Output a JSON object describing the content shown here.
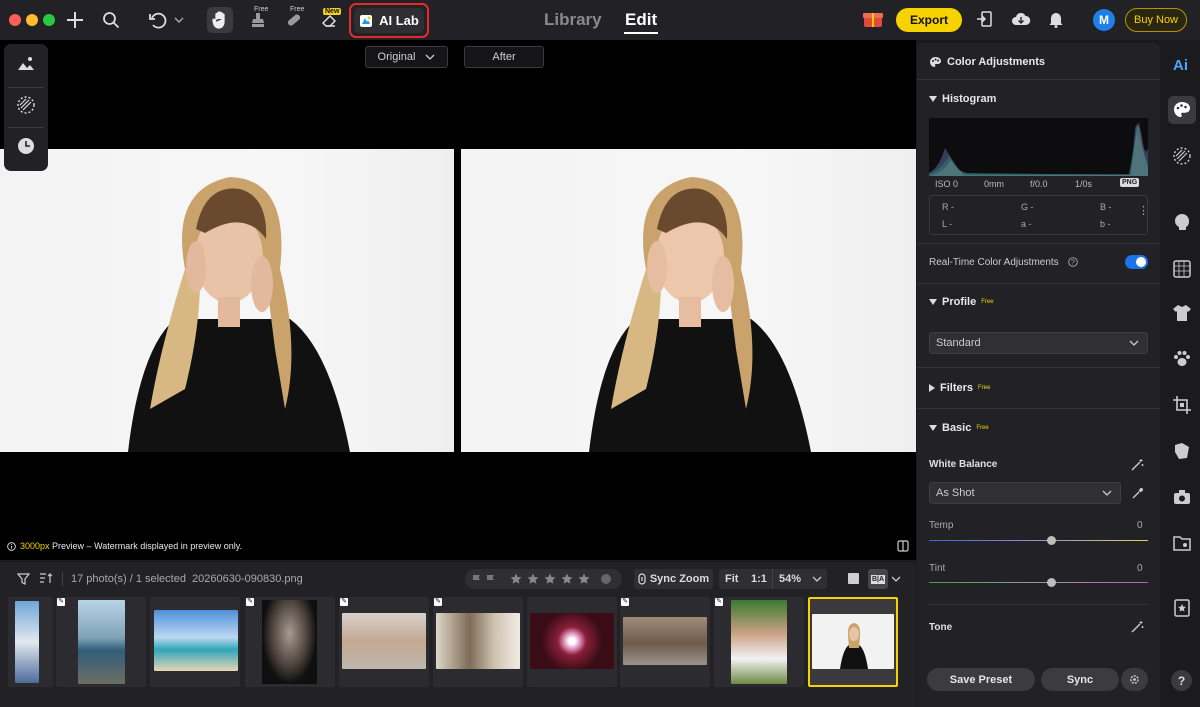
{
  "toolbar": {
    "free_tag_1": "Free",
    "free_tag_2": "Free",
    "new_tag": "New",
    "ai_lab_label": "AI Lab",
    "mode_library": "Library",
    "mode_edit": "Edit",
    "export_label": "Export",
    "buy_now_label": "Buy Now",
    "avatar_letter": "M",
    "accent_color": "#f5d200"
  },
  "canvas": {
    "view_original": "Original",
    "view_after": "After",
    "preview_px": "3000px",
    "preview_note": "Preview – Watermark displayed in preview only."
  },
  "filmstrip": {
    "photo_count": "17 photo(s) / 1 selected",
    "filename": "20260630-090830.png",
    "sync_zoom": "Sync Zoom",
    "fit": "Fit",
    "one_to_one": "1:1",
    "zoom_level": "54%",
    "compare_label": "B|A"
  },
  "panel": {
    "header": "Color Adjustments",
    "histogram_title": "Histogram",
    "iso": "ISO 0",
    "focal": "0mm",
    "aperture": "f/0.0",
    "shutter": "1/0s",
    "format_badge": "PNG",
    "r": "R -",
    "g": "G -",
    "b": "B -",
    "l": "L -",
    "a": "a -",
    "b_lab": "b -",
    "realtime_label": "Real-Time Color Adjustments",
    "realtime_on": true,
    "profile_title": "Profile",
    "profile_free": "Free",
    "profile_value": "Standard",
    "filters_title": "Filters",
    "filters_free": "Free",
    "basic_title": "Basic",
    "basic_free": "Free",
    "white_balance_label": "White Balance",
    "white_balance_value": "As Shot",
    "temp_label": "Temp",
    "temp_value": "0",
    "tint_label": "Tint",
    "tint_value": "0",
    "tone_label": "Tone",
    "save_preset": "Save Preset",
    "sync": "Sync"
  },
  "rail": {
    "ai_label": "Ai",
    "help": "?"
  }
}
